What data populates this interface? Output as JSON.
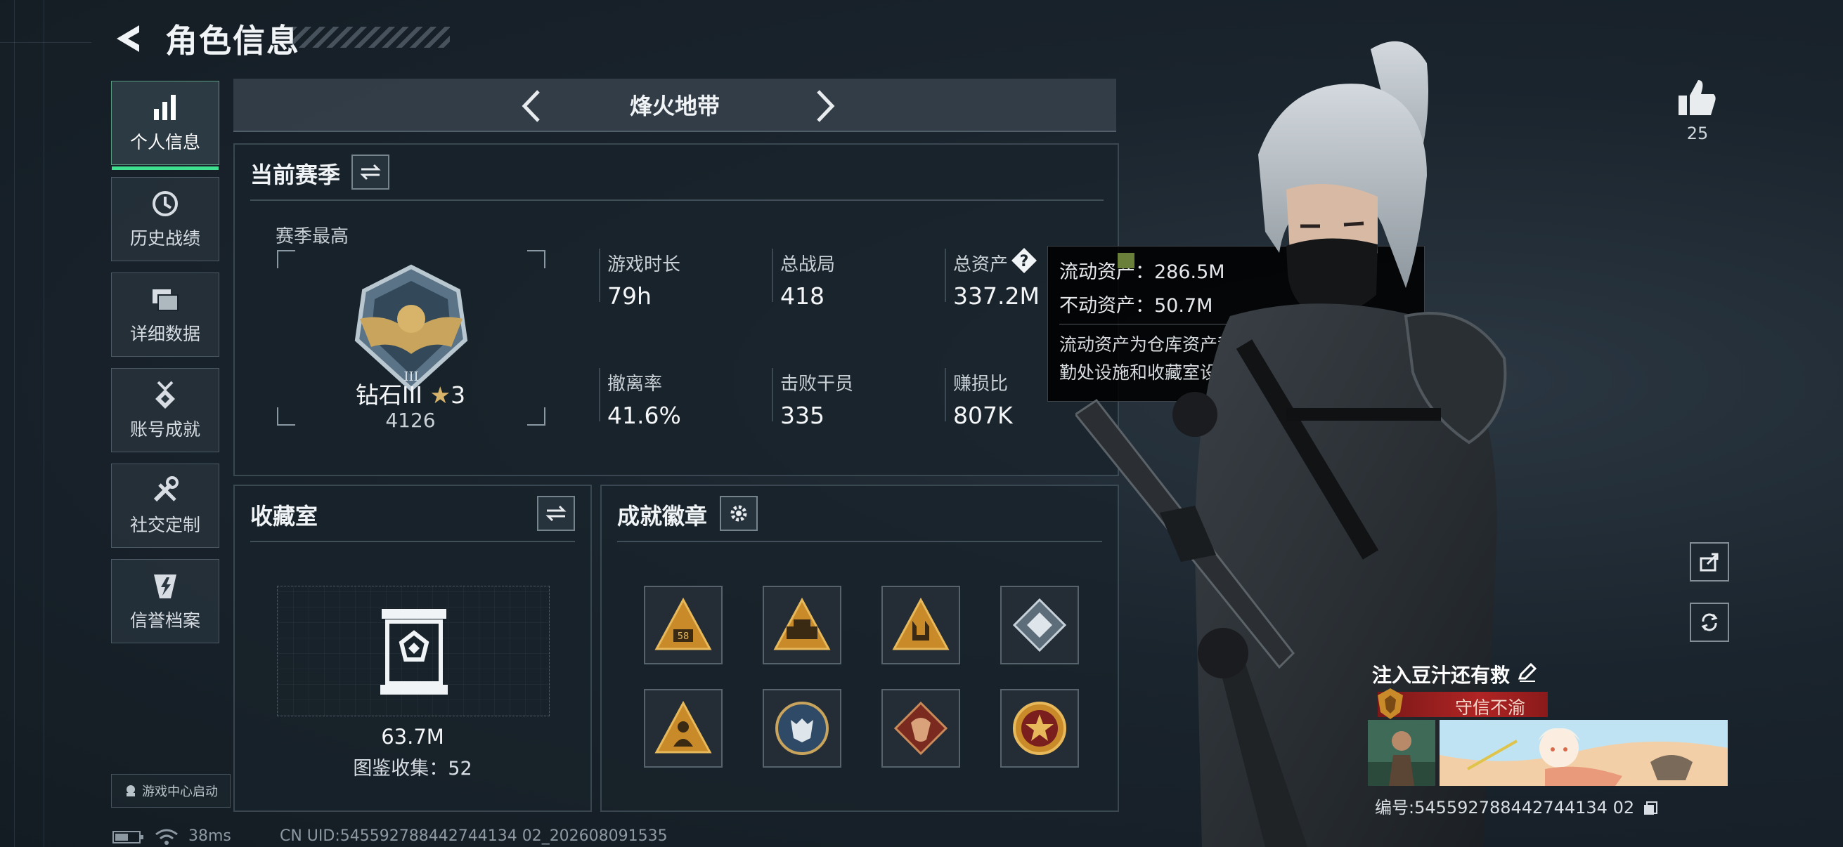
{
  "header": {
    "title": "角色信息"
  },
  "sidebar": {
    "items": [
      {
        "label": "个人信息",
        "icon": "bar-chart-icon",
        "active": true
      },
      {
        "label": "历史战绩",
        "icon": "history-clock-icon",
        "active": false
      },
      {
        "label": "详细数据",
        "icon": "folder-stack-icon",
        "active": false
      },
      {
        "label": "账号成就",
        "icon": "medal-icon",
        "active": false
      },
      {
        "label": "社交定制",
        "icon": "tools-icon",
        "active": false
      },
      {
        "label": "信誉档案",
        "icon": "shield-bolt-icon",
        "active": false
      }
    ],
    "game_center_label": "游戏中心启动"
  },
  "mode_selector": {
    "title": "烽火地带"
  },
  "season": {
    "title": "当前赛季",
    "best_label": "赛季最高",
    "rank_name": "钻石III",
    "rank_stars": "3",
    "rank_score": "4126",
    "stats": [
      {
        "label": "游戏时长",
        "value": "79h"
      },
      {
        "label": "总战局",
        "value": "418"
      },
      {
        "label": "总资产",
        "value": "337.2M"
      },
      {
        "label": "撤离率",
        "value": "41.6%"
      },
      {
        "label": "击败干员",
        "value": "335"
      },
      {
        "label": "赚损比",
        "value": "807K"
      }
    ]
  },
  "tooltip": {
    "liquid": "流动资产：286.5M",
    "fixed": "不动资产：50.7M",
    "note": "流动资产为仓库资产和哈夫币，不动资产为特勤处设施和收藏室设施"
  },
  "collection": {
    "title": "收藏室",
    "value": "63.7M",
    "catalog": "图鉴收集：52"
  },
  "achievements": {
    "title": "成就徽章",
    "badges": [
      "badge-58-icon",
      "badge-tank-icon",
      "badge-horns-icon",
      "badge-gem-icon",
      "badge-soldier-icon",
      "badge-wolf-icon",
      "badge-dragon-icon",
      "badge-star-icon"
    ]
  },
  "profile": {
    "likes": "25",
    "name": "注入豆汁还有救",
    "title_badge": "守信不渝",
    "id_line": "编号:545592788442744134 02"
  },
  "status": {
    "ping": "38ms",
    "uid": "CN UID:545592788442744134 02_202608091535"
  },
  "colors": {
    "accent": "#3fe08f",
    "banner_red": "#b02424",
    "panel_bg": "#18222a"
  }
}
